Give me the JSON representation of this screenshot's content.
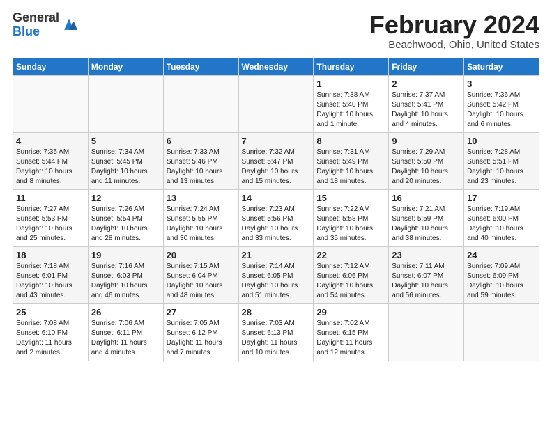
{
  "logo": {
    "general": "General",
    "blue": "Blue"
  },
  "header": {
    "month": "February 2024",
    "location": "Beachwood, Ohio, United States"
  },
  "days_of_week": [
    "Sunday",
    "Monday",
    "Tuesday",
    "Wednesday",
    "Thursday",
    "Friday",
    "Saturday"
  ],
  "weeks": [
    [
      {
        "day": "",
        "info": ""
      },
      {
        "day": "",
        "info": ""
      },
      {
        "day": "",
        "info": ""
      },
      {
        "day": "",
        "info": ""
      },
      {
        "day": "1",
        "info": "Sunrise: 7:38 AM\nSunset: 5:40 PM\nDaylight: 10 hours\nand 1 minute."
      },
      {
        "day": "2",
        "info": "Sunrise: 7:37 AM\nSunset: 5:41 PM\nDaylight: 10 hours\nand 4 minutes."
      },
      {
        "day": "3",
        "info": "Sunrise: 7:36 AM\nSunset: 5:42 PM\nDaylight: 10 hours\nand 6 minutes."
      }
    ],
    [
      {
        "day": "4",
        "info": "Sunrise: 7:35 AM\nSunset: 5:44 PM\nDaylight: 10 hours\nand 8 minutes."
      },
      {
        "day": "5",
        "info": "Sunrise: 7:34 AM\nSunset: 5:45 PM\nDaylight: 10 hours\nand 11 minutes."
      },
      {
        "day": "6",
        "info": "Sunrise: 7:33 AM\nSunset: 5:46 PM\nDaylight: 10 hours\nand 13 minutes."
      },
      {
        "day": "7",
        "info": "Sunrise: 7:32 AM\nSunset: 5:47 PM\nDaylight: 10 hours\nand 15 minutes."
      },
      {
        "day": "8",
        "info": "Sunrise: 7:31 AM\nSunset: 5:49 PM\nDaylight: 10 hours\nand 18 minutes."
      },
      {
        "day": "9",
        "info": "Sunrise: 7:29 AM\nSunset: 5:50 PM\nDaylight: 10 hours\nand 20 minutes."
      },
      {
        "day": "10",
        "info": "Sunrise: 7:28 AM\nSunset: 5:51 PM\nDaylight: 10 hours\nand 23 minutes."
      }
    ],
    [
      {
        "day": "11",
        "info": "Sunrise: 7:27 AM\nSunset: 5:53 PM\nDaylight: 10 hours\nand 25 minutes."
      },
      {
        "day": "12",
        "info": "Sunrise: 7:26 AM\nSunset: 5:54 PM\nDaylight: 10 hours\nand 28 minutes."
      },
      {
        "day": "13",
        "info": "Sunrise: 7:24 AM\nSunset: 5:55 PM\nDaylight: 10 hours\nand 30 minutes."
      },
      {
        "day": "14",
        "info": "Sunrise: 7:23 AM\nSunset: 5:56 PM\nDaylight: 10 hours\nand 33 minutes."
      },
      {
        "day": "15",
        "info": "Sunrise: 7:22 AM\nSunset: 5:58 PM\nDaylight: 10 hours\nand 35 minutes."
      },
      {
        "day": "16",
        "info": "Sunrise: 7:21 AM\nSunset: 5:59 PM\nDaylight: 10 hours\nand 38 minutes."
      },
      {
        "day": "17",
        "info": "Sunrise: 7:19 AM\nSunset: 6:00 PM\nDaylight: 10 hours\nand 40 minutes."
      }
    ],
    [
      {
        "day": "18",
        "info": "Sunrise: 7:18 AM\nSunset: 6:01 PM\nDaylight: 10 hours\nand 43 minutes."
      },
      {
        "day": "19",
        "info": "Sunrise: 7:16 AM\nSunset: 6:03 PM\nDaylight: 10 hours\nand 46 minutes."
      },
      {
        "day": "20",
        "info": "Sunrise: 7:15 AM\nSunset: 6:04 PM\nDaylight: 10 hours\nand 48 minutes."
      },
      {
        "day": "21",
        "info": "Sunrise: 7:14 AM\nSunset: 6:05 PM\nDaylight: 10 hours\nand 51 minutes."
      },
      {
        "day": "22",
        "info": "Sunrise: 7:12 AM\nSunset: 6:06 PM\nDaylight: 10 hours\nand 54 minutes."
      },
      {
        "day": "23",
        "info": "Sunrise: 7:11 AM\nSunset: 6:07 PM\nDaylight: 10 hours\nand 56 minutes."
      },
      {
        "day": "24",
        "info": "Sunrise: 7:09 AM\nSunset: 6:09 PM\nDaylight: 10 hours\nand 59 minutes."
      }
    ],
    [
      {
        "day": "25",
        "info": "Sunrise: 7:08 AM\nSunset: 6:10 PM\nDaylight: 11 hours\nand 2 minutes."
      },
      {
        "day": "26",
        "info": "Sunrise: 7:06 AM\nSunset: 6:11 PM\nDaylight: 11 hours\nand 4 minutes."
      },
      {
        "day": "27",
        "info": "Sunrise: 7:05 AM\nSunset: 6:12 PM\nDaylight: 11 hours\nand 7 minutes."
      },
      {
        "day": "28",
        "info": "Sunrise: 7:03 AM\nSunset: 6:13 PM\nDaylight: 11 hours\nand 10 minutes."
      },
      {
        "day": "29",
        "info": "Sunrise: 7:02 AM\nSunset: 6:15 PM\nDaylight: 11 hours\nand 12 minutes."
      },
      {
        "day": "",
        "info": ""
      },
      {
        "day": "",
        "info": ""
      }
    ]
  ]
}
